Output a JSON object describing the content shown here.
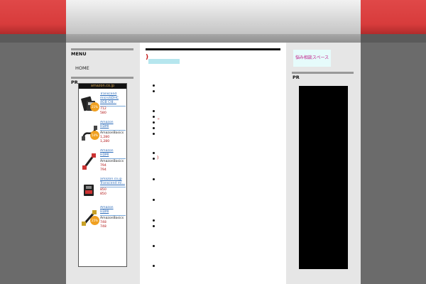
{
  "menu": {
    "title": "MENU",
    "items": [
      {
        "label": "HOME"
      }
    ]
  },
  "pr": {
    "title": "PR",
    "widget_header": "amazon.co.jp",
    "products": [
      {
        "title_lines": [
          "Transcend",
          "microSDHC",
          "4GB Cl8..."
        ],
        "brand": "",
        "price": "712",
        "price2": "580",
        "badge": "21%",
        "icon": "microsd-card-icon"
      },
      {
        "title_lines": [
          "Amazon",
          "HDMI"
        ],
        "brand": "AmazonBasics",
        "price": "1,280",
        "price2": "1,280",
        "badge": "54%",
        "icon": "hdmi-cable-icon"
      },
      {
        "title_lines": [
          "Amazon",
          "HDMI"
        ],
        "brand": "AmazonBasics",
        "price": "794",
        "price2": "794",
        "badge": "",
        "icon": "hdmi-cable-icon"
      },
      {
        "title_lines": [
          "amazon.co.jp",
          "Transcend mi..."
        ],
        "brand": "",
        "price": "850",
        "price2": "850",
        "badge": "",
        "icon": "sd-card-icon"
      },
      {
        "title_lines": [
          "Amazon",
          "HDMI"
        ],
        "brand": "AmazonBasics",
        "price": "748",
        "price2": "748",
        "badge": "25%",
        "icon": "hdmi-cable-icon"
      }
    ]
  },
  "main": {
    "heading_mark": ")",
    "red_marks": [
      "\"",
      ")"
    ]
  },
  "right": {
    "banner_text": "悩み相談スペース",
    "pr_title": "PR"
  },
  "colors": {
    "accent_red": "#d83c3c",
    "link_blue": "#2a6ab8",
    "price_red": "#b01010"
  }
}
